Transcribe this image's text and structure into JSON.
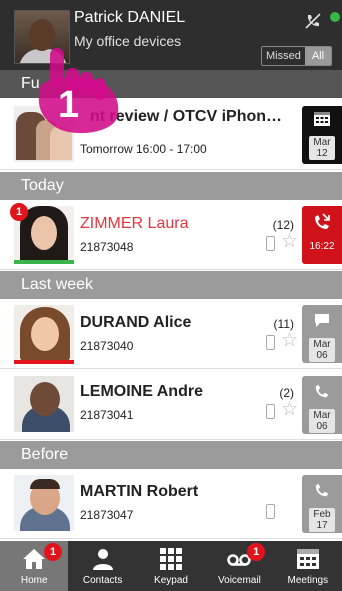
{
  "header": {
    "name": "Patrick DANIEL",
    "subtitle": "My office devices",
    "filter": {
      "missed": "Missed",
      "all": "All"
    }
  },
  "sections": {
    "future": "Fu",
    "today": "Today",
    "last_week": "Last week",
    "before": "Before"
  },
  "rows": [
    {
      "title": "nt review / OTCV iPhon…",
      "detail": "Tomorrow 16:00 - 17:00",
      "tile": {
        "icon": "calendar-icon",
        "d1": "Mar",
        "d2": "12"
      }
    },
    {
      "title": "ZIMMER Laura",
      "number": "21873048",
      "count": "(12)",
      "badge": "1",
      "tile": {
        "icon": "phone-missed-icon",
        "d1": "16:22"
      }
    },
    {
      "title": "DURAND Alice",
      "number": "21873040",
      "count": "(11)",
      "tile": {
        "icon": "message-icon",
        "d1": "Mar",
        "d2": "06"
      }
    },
    {
      "title": "LEMOINE Andre",
      "number": "21873041",
      "count": "(2)",
      "tile": {
        "icon": "phone-icon",
        "d1": "Mar",
        "d2": "06"
      }
    },
    {
      "title": "MARTIN Robert",
      "number": "21873047",
      "tile": {
        "icon": "phone-icon",
        "d1": "Feb",
        "d2": "17"
      }
    }
  ],
  "tabs": [
    {
      "label": "Home",
      "icon": "home-icon",
      "badge": "1",
      "active": true
    },
    {
      "label": "Contacts",
      "icon": "contacts-icon"
    },
    {
      "label": "Keypad",
      "icon": "keypad-icon"
    },
    {
      "label": "Voicemail",
      "icon": "voicemail-icon",
      "badge": "1"
    },
    {
      "label": "Meetings",
      "icon": "meetings-icon"
    }
  ],
  "overlay": {
    "step": "1"
  },
  "colors": {
    "header_bg": "#2e2e2e",
    "section_bg": "#9b9b9b",
    "missed_red": "#d0121a",
    "presence_green": "#39b54a",
    "presence_red": "#e1141c"
  }
}
